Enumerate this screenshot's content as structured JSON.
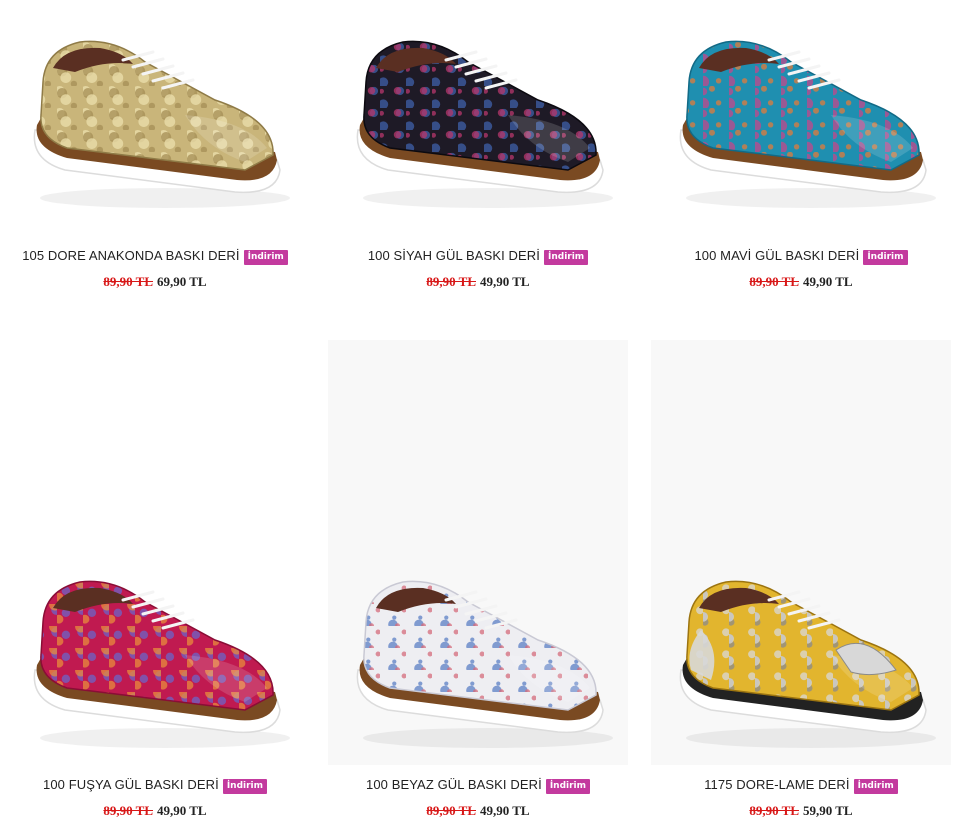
{
  "badge_label": "İndirim",
  "products": [
    {
      "title": "105 DORE ANAKONDA BASKI DERİ",
      "old_price": "89,90 TL",
      "new_price": "69,90 TL",
      "colors": {
        "upper": "#c9b57a",
        "upper_dark": "#8f7b47",
        "accent": "#ece0ac",
        "accent2": "#a58f55"
      }
    },
    {
      "title": "100 SİYAH GÜL BASKI DERİ",
      "old_price": "89,90 TL",
      "new_price": "49,90 TL",
      "colors": {
        "upper": "#1e1a26",
        "upper_dark": "#0c0a10",
        "accent": "#b5356a",
        "accent2": "#3d5ea8"
      }
    },
    {
      "title": "100 MAVİ GÜL BASKI DERİ",
      "old_price": "89,90 TL",
      "new_price": "49,90 TL",
      "colors": {
        "upper": "#1f8fb0",
        "upper_dark": "#126a86",
        "accent": "#c2478a",
        "accent2": "#e07a3a"
      }
    },
    {
      "title": "100 FUŞYA GÜL BASKI DERİ",
      "old_price": "89,90 TL",
      "new_price": "49,90 TL",
      "colors": {
        "upper": "#c01a50",
        "upper_dark": "#8a0d36",
        "accent": "#6c63c7",
        "accent2": "#e88a3c"
      }
    },
    {
      "title": "100 BEYAZ GÜL BASKI DERİ",
      "old_price": "89,90 TL",
      "new_price": "49,90 TL",
      "colors": {
        "upper": "#eeeef2",
        "upper_dark": "#c9c9d4",
        "accent": "#d46a7a",
        "accent2": "#5a7ec4"
      }
    },
    {
      "title": "1175 DORE-LAME DERİ",
      "old_price": "89,90 TL",
      "new_price": "59,90 TL",
      "colors": {
        "upper": "#e2b52e",
        "upper_dark": "#9c7410",
        "accent": "#d8d8d8",
        "accent2": "#8a8a8a"
      }
    }
  ]
}
